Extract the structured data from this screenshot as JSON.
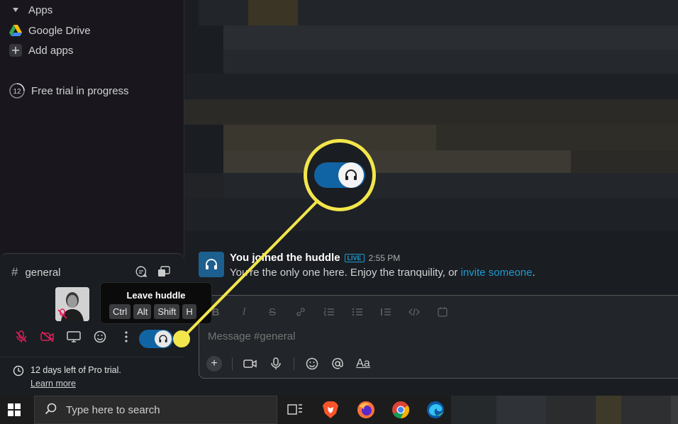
{
  "sidebar": {
    "apps_header": "Apps",
    "items": [
      {
        "label": "Google Drive",
        "icon": "google-drive-icon"
      },
      {
        "label": "Add apps",
        "icon": "plus-icon"
      }
    ],
    "trial": {
      "badge": "12",
      "label": "Free trial in progress"
    }
  },
  "huddle_panel": {
    "channel": "general",
    "tooltip": {
      "title": "Leave huddle",
      "keys": [
        "Ctrl",
        "Alt",
        "Shift",
        "H"
      ]
    },
    "footer": {
      "line1": "12 days left of Pro trial.",
      "line2": "Learn more"
    }
  },
  "message": {
    "title": "You joined the huddle",
    "badge": "LIVE",
    "time": "2:55 PM",
    "body": "You're the only one here. Enjoy the tranquility, or ",
    "link": "invite someone",
    "body_end": "."
  },
  "composer": {
    "placeholder": "Message #general",
    "format_label": "Aa"
  },
  "taskbar": {
    "search_placeholder": "Type here to search"
  },
  "colors": {
    "accent": "#1164a3",
    "callout": "#f2e64c",
    "link": "#1d9bd1"
  }
}
